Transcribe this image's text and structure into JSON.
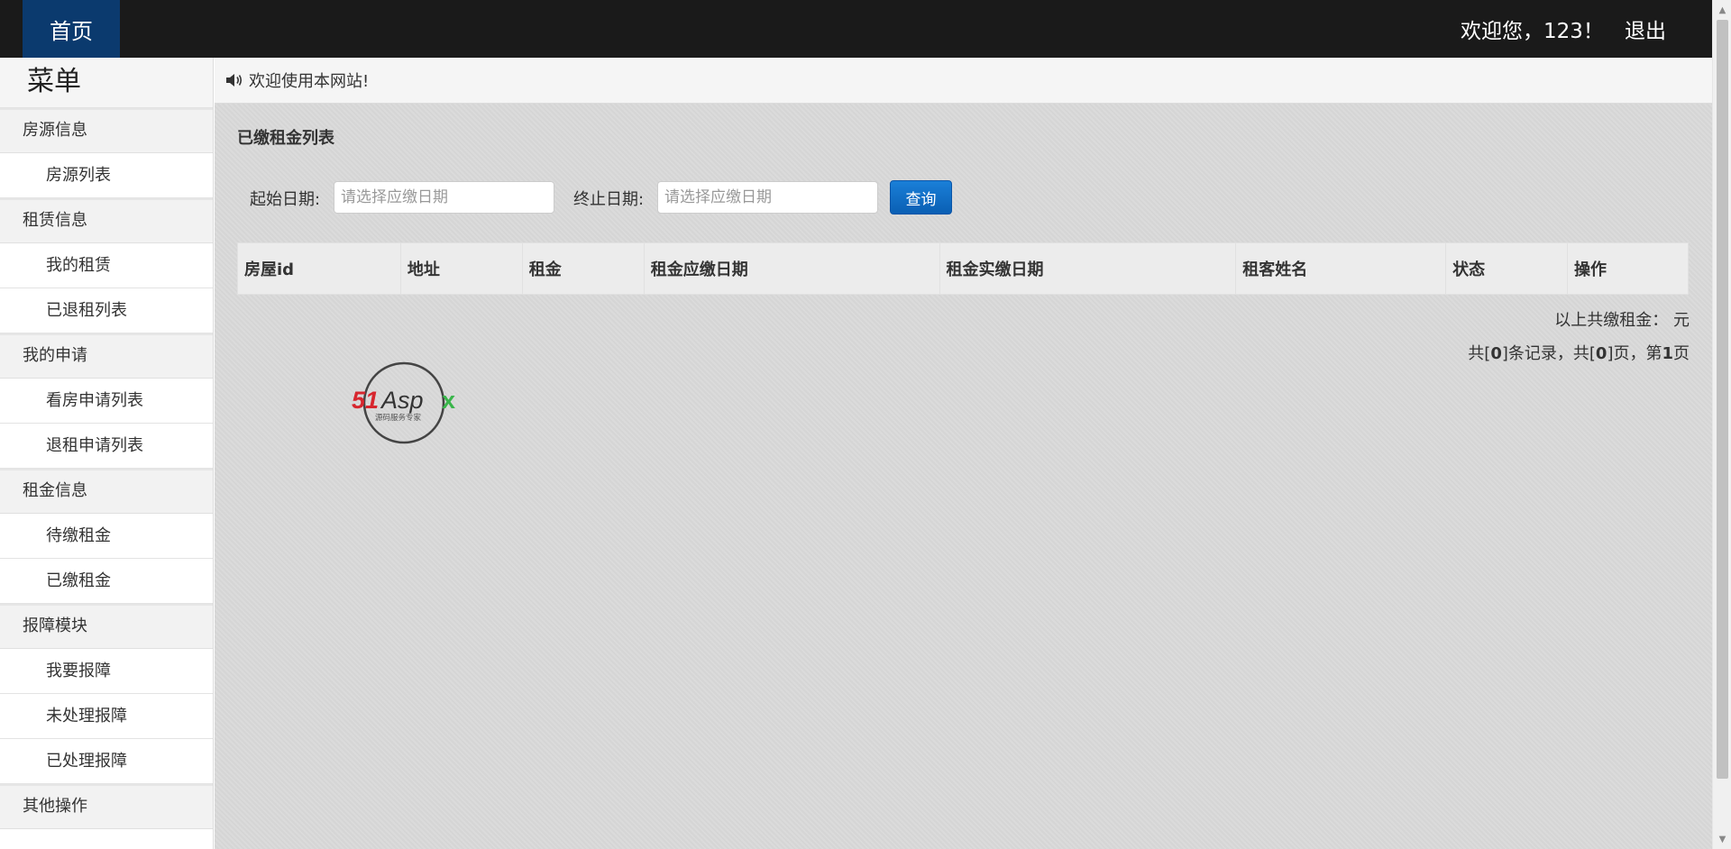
{
  "topbar": {
    "home_label": "首页",
    "welcome_text": "欢迎您，123！",
    "logout_label": "退出"
  },
  "sidebar": {
    "title": "菜单",
    "groups": [
      {
        "label": "房源信息",
        "items": [
          "房源列表"
        ]
      },
      {
        "label": "租赁信息",
        "items": [
          "我的租赁",
          "已退租列表"
        ]
      },
      {
        "label": "我的申请",
        "items": [
          "看房申请列表",
          "退租申请列表"
        ]
      },
      {
        "label": "租金信息",
        "items": [
          "待缴租金",
          "已缴租金"
        ]
      },
      {
        "label": "报障模块",
        "items": [
          "我要报障",
          "未处理报障",
          "已处理报障"
        ]
      },
      {
        "label": "其他操作",
        "items": []
      }
    ]
  },
  "notice": {
    "text": "欢迎使用本网站!"
  },
  "page": {
    "title": "已缴租金列表"
  },
  "filter": {
    "start_label": "起始日期:",
    "start_placeholder": "请选择应缴日期",
    "end_label": "终止日期:",
    "end_placeholder": "请选择应缴日期",
    "query_label": "查询"
  },
  "table": {
    "columns": [
      "房屋id",
      "地址",
      "租金",
      "租金应缴日期",
      "租金实缴日期",
      "租客姓名",
      "状态",
      "操作"
    ],
    "rows": []
  },
  "summary": {
    "text": "以上共缴租金：  元"
  },
  "pager": {
    "prefix": "共[",
    "total_records": "0",
    "mid1": "]条记录，共[",
    "total_pages": "0",
    "mid2": "]页，第",
    "current_page": "1",
    "suffix": "页"
  },
  "logo": {
    "brand": "51Aspx",
    "tagline": "源码服务专家"
  },
  "colors": {
    "topbar": "#1a1a1a",
    "home_active": "#0b3a6e",
    "query_button": "#0a5fb4",
    "main_bg": "#d9d9d9"
  }
}
